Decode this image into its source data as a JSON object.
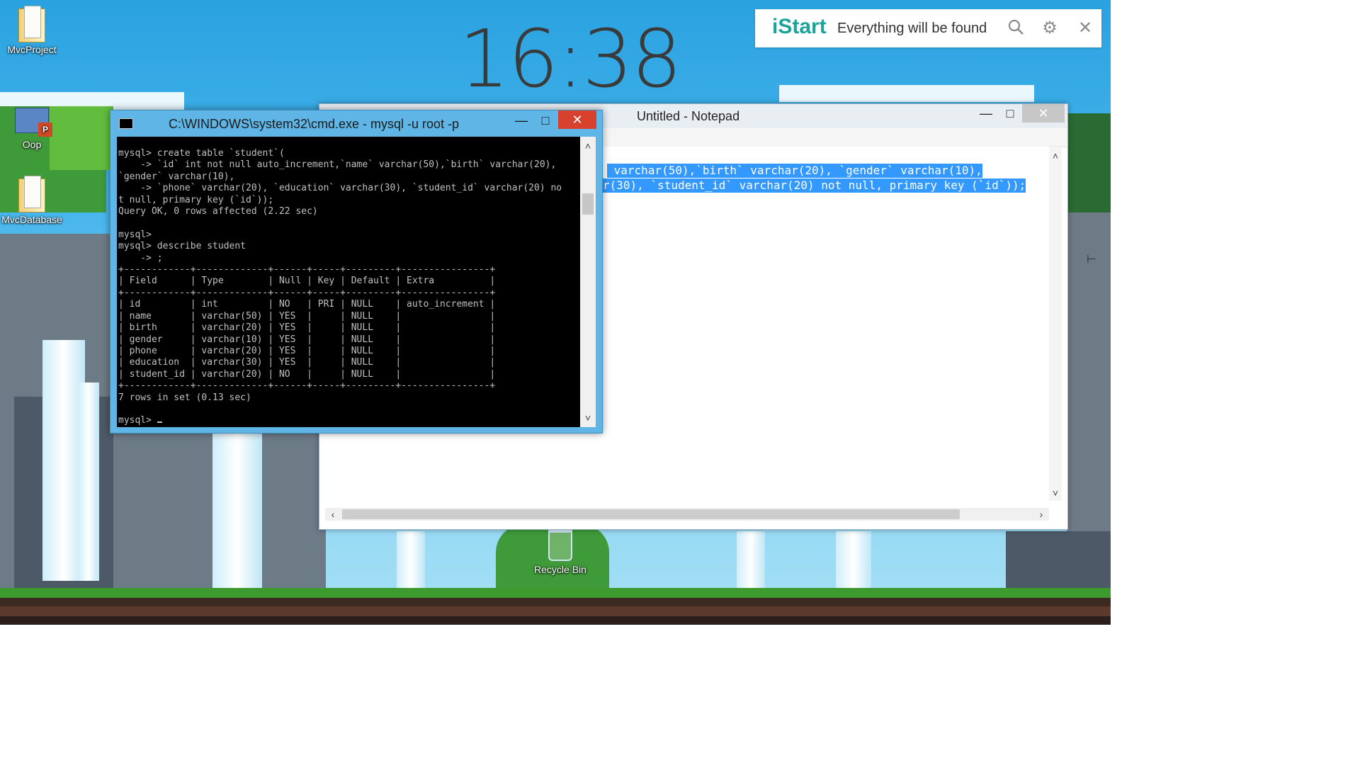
{
  "desktop": {
    "icons": [
      {
        "label": "MvcProject",
        "type": "folder"
      },
      {
        "label": "Oop",
        "type": "powerpoint"
      },
      {
        "label": "MvcDatabase",
        "type": "folder"
      },
      {
        "label": "Recycle Bin",
        "type": "recycle-bin"
      }
    ],
    "clock": {
      "time": "16:38"
    }
  },
  "istart": {
    "logo": "iStart",
    "tagline": "Everything will be found",
    "icons": [
      "search-icon",
      "gear-icon",
      "close-icon"
    ]
  },
  "notepad": {
    "title": "Untitled - Notepad",
    "buttons": {
      "minimize": "—",
      "maximize": "□",
      "close": "✕"
    },
    "selected_lines": [
      " varchar(50),`birth` varchar(20), `gender` varchar(10),",
      "r(30), `student_id` varchar(20) not null, primary key (`id`));"
    ],
    "selection_color": "#3399ff"
  },
  "cmd": {
    "title": "C:\\WINDOWS\\system32\\cmd.exe - mysql  -u root -p",
    "buttons": {
      "minimize": "—",
      "maximize": "□",
      "close": "✕"
    },
    "lines": [
      "mysql> create table `student`(",
      "    -> `id` int not null auto_increment,`name` varchar(50),`birth` varchar(20),",
      "`gender` varchar(10),",
      "    -> `phone` varchar(20), `education` varchar(30), `student_id` varchar(20) no",
      "t null, primary key (`id`));",
      "Query OK, 0 rows affected (2.22 sec)",
      "",
      "mysql>",
      "mysql> describe student",
      "    -> ;",
      "+------------+-------------+------+-----+---------+----------------+",
      "| Field      | Type        | Null | Key | Default | Extra          |",
      "+------------+-------------+------+-----+---------+----------------+",
      "| id         | int         | NO   | PRI | NULL    | auto_increment |",
      "| name       | varchar(50) | YES  |     | NULL    |                |",
      "| birth      | varchar(20) | YES  |     | NULL    |                |",
      "| gender     | varchar(10) | YES  |     | NULL    |                |",
      "| phone      | varchar(20) | YES  |     | NULL    |                |",
      "| education  | varchar(30) | YES  |     | NULL    |                |",
      "| student_id | varchar(20) | NO   |     | NULL    |                |",
      "+------------+-------------+------+-----+---------+----------------+",
      "7 rows in set (0.13 sec)",
      "",
      "mysql> "
    ]
  }
}
